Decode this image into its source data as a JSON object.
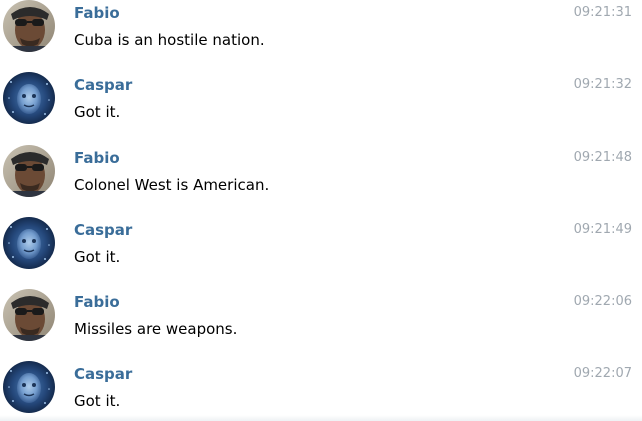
{
  "messages": [
    {
      "sender": "Fabio",
      "text": "Cuba is an hostile nation.",
      "time": "09:21:31",
      "avatar": "fabio-avatar"
    },
    {
      "sender": "Caspar",
      "text": "Got it.",
      "time": "09:21:32",
      "avatar": "caspar-avatar"
    },
    {
      "sender": "Fabio",
      "text": "Colonel West is American.",
      "time": "09:21:48",
      "avatar": "fabio-avatar"
    },
    {
      "sender": "Caspar",
      "text": "Got it.",
      "time": "09:21:49",
      "avatar": "caspar-avatar"
    },
    {
      "sender": "Fabio",
      "text": "Missiles are weapons.",
      "time": "09:22:06",
      "avatar": "fabio-avatar"
    },
    {
      "sender": "Caspar",
      "text": "Got it.",
      "time": "09:22:07",
      "avatar": "caspar-avatar"
    }
  ],
  "colors": {
    "sender_name": "#3a6d99",
    "timestamp": "#a0a8b0",
    "message_text": "#000000",
    "background": "#ffffff"
  }
}
